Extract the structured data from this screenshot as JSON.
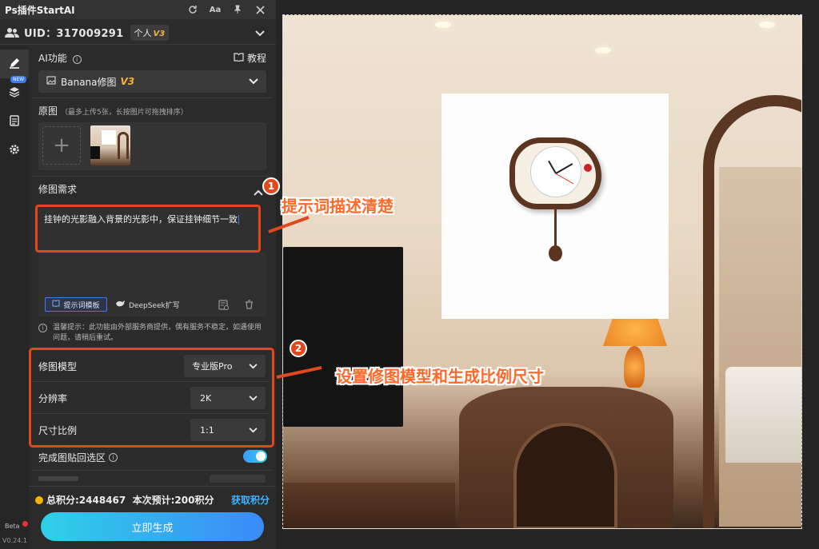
{
  "app": {
    "title": "Ps插件StartAI"
  },
  "user": {
    "uid_label": "UID：317009291",
    "plan": "个人",
    "plan_version": "V3"
  },
  "sidenav": {
    "new_badge": "NEW",
    "beta": "Beta",
    "version": "V0.24.1"
  },
  "ai_feature": {
    "label": "AI功能",
    "tutorial": "教程",
    "selected": "Banana修图",
    "selected_version": "V3"
  },
  "source": {
    "label": "原图",
    "hint": "（最多上传5张，长按图片可拖拽排序）"
  },
  "prompt": {
    "label": "修图需求",
    "value": "挂钟的光影融入背景的光影中，保证挂钟细节一致",
    "template_button": "提示词模板",
    "deepseek_button": "DeepSeek扩写"
  },
  "notice": "温馨提示：此功能由外部服务商提供，偶有服务不稳定，如遇使用问题，请稍后重试。",
  "settings": {
    "model_label": "修图模型",
    "model_value": "专业版Pro",
    "resolution_label": "分辨率",
    "resolution_value": "2K",
    "ratio_label": "尺寸比例",
    "ratio_value": "1:1"
  },
  "paste_back": {
    "label": "完成图贴回选区",
    "enabled": true
  },
  "footer": {
    "points": "总积分:2448467  本次预计:200积分",
    "get_points": "获取积分",
    "generate": "立即生成"
  },
  "annotations": {
    "step1": "1",
    "step1_text": "提示词描述清楚",
    "step2": "2",
    "step2_text": "设置修图模型和生成比例尺寸"
  },
  "colors": {
    "accent": "#e0481e",
    "brand_blue": "#3d7bf5",
    "annotation_text": "#ff6a2b"
  }
}
